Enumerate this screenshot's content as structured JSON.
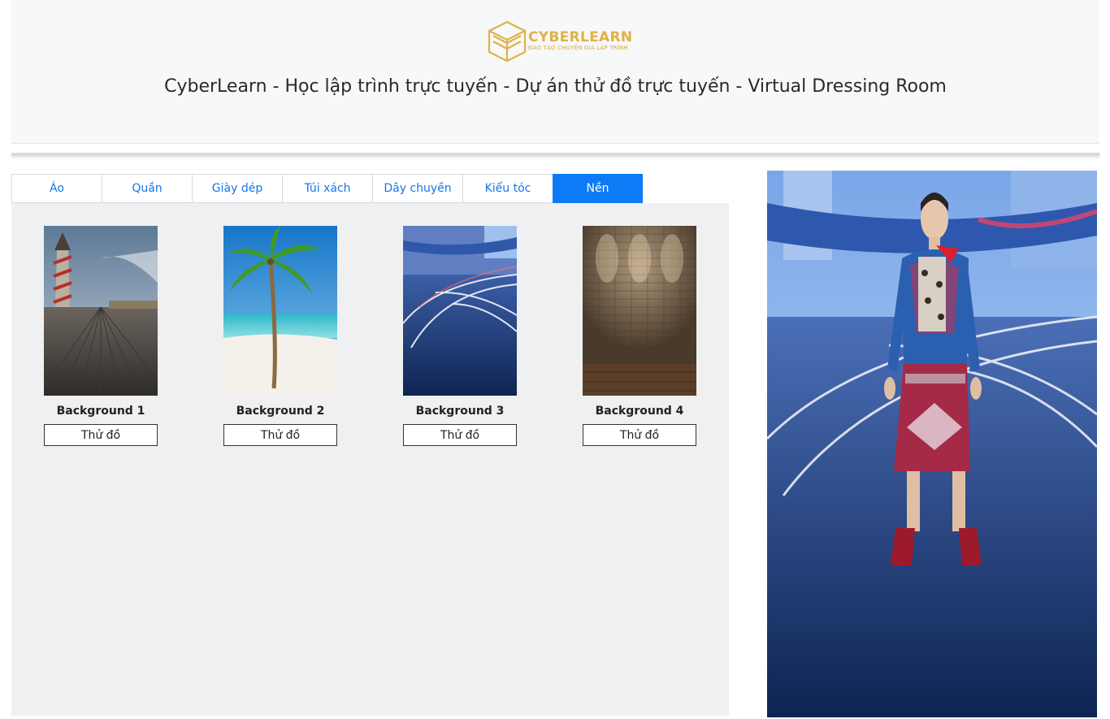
{
  "header": {
    "logo_text": "CYBERLEARN",
    "logo_subtext": "ĐÀO TẠO CHUYÊN GIA LẬP TRÌNH",
    "title": "CyberLearn - Học lập trình trực tuyến - Dự án thử đồ trực tuyến - Virtual Dressing Room"
  },
  "tabs": [
    {
      "label": "Áo",
      "active": false
    },
    {
      "label": "Quần",
      "active": false
    },
    {
      "label": "Giày dép",
      "active": false
    },
    {
      "label": "Túi xách",
      "active": false
    },
    {
      "label": "Dây chuyền",
      "active": false
    },
    {
      "label": "Kiểu tóc",
      "active": false
    },
    {
      "label": "Nền",
      "active": true
    }
  ],
  "products": [
    {
      "name": "Background 1",
      "button": "Thử đồ",
      "thumb": "pier-helter-skelter"
    },
    {
      "name": "Background 2",
      "button": "Thử đồ",
      "thumb": "palm-beach"
    },
    {
      "name": "Background 3",
      "button": "Thử đồ",
      "thumb": "city-light-trails"
    },
    {
      "name": "Background 4",
      "button": "Thử đồ",
      "thumb": "brick-wall-spotlights"
    }
  ],
  "colors": {
    "accent": "#0d7bf5",
    "tab_text": "#1a73e8",
    "logo_gold": "#e0b14a",
    "panel_bg": "#eff0f1"
  }
}
